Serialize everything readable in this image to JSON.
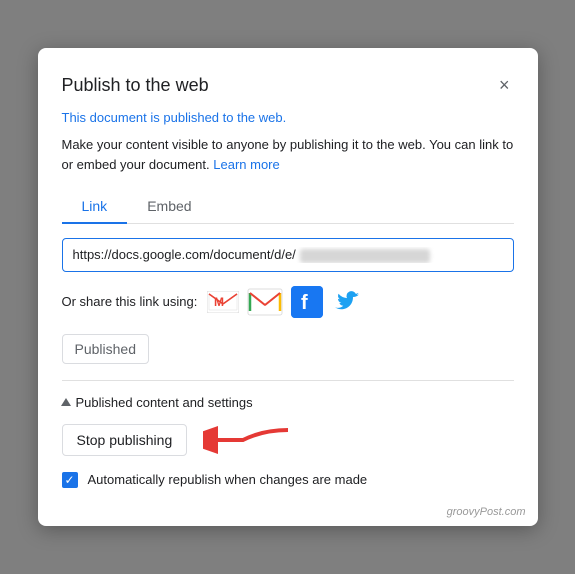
{
  "modal": {
    "title": "Publish to the web",
    "close_label": "×",
    "published_status": "This document is published to the web.",
    "description": "Make your content visible to anyone by publishing it to the web. You can link to or embed your document.",
    "learn_more": "Learn more",
    "tabs": [
      {
        "label": "Link",
        "active": true
      },
      {
        "label": "Embed",
        "active": false
      }
    ],
    "url_prefix": "https://docs.google.com/document/d/e/",
    "share_label": "Or share this link using:",
    "published_badge": "Published",
    "divider": true,
    "settings_section": {
      "toggle_label": "Published content and settings",
      "stop_button": "Stop publishing",
      "checkbox_label": "Automatically republish when changes are made",
      "checkbox_checked": true
    },
    "watermark": "groovyPost.com"
  }
}
